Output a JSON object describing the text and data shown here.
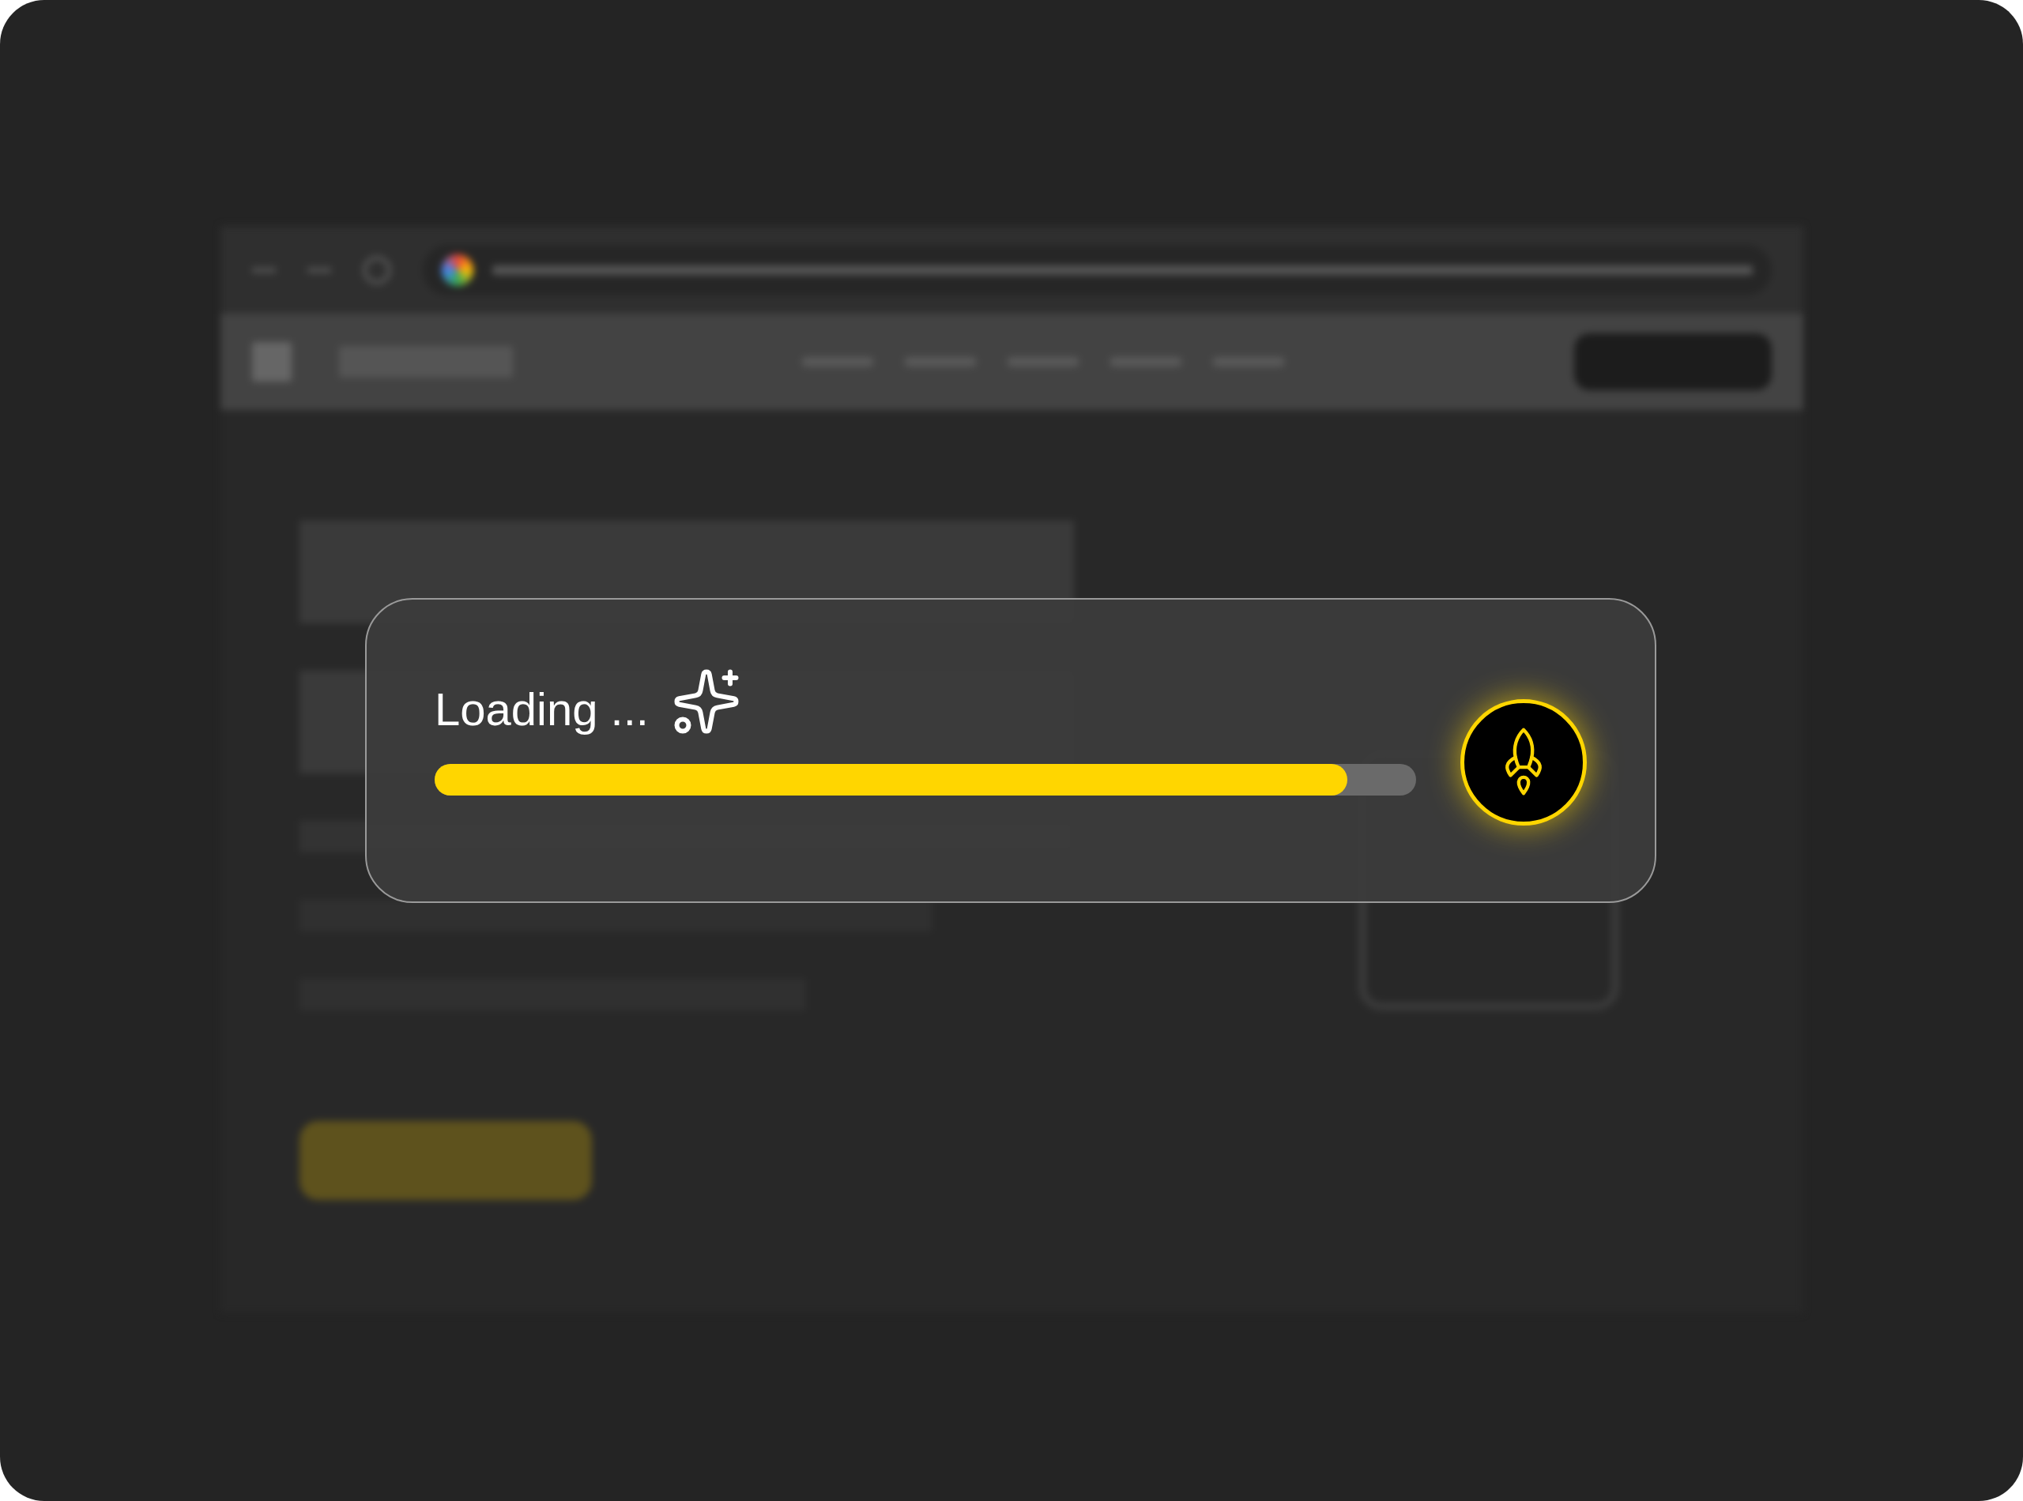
{
  "loader": {
    "label": "Loading ...",
    "level": 0.93
  }
}
